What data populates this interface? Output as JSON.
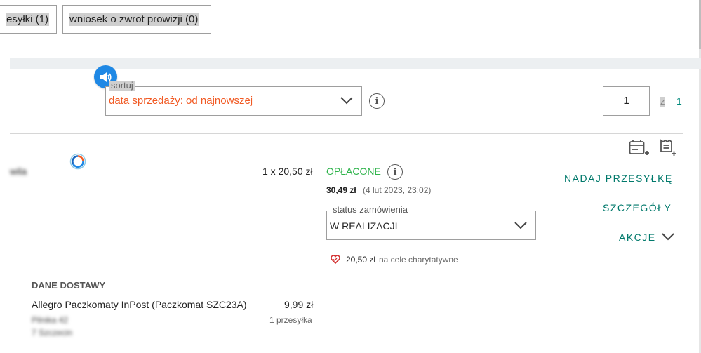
{
  "tabs": [
    {
      "label": "esyłki (1)"
    },
    {
      "label": "wniosek o zwrot prowizji (0)"
    }
  ],
  "sort": {
    "legend": "sortuj",
    "value": "data sprzedaży: od najnowszej"
  },
  "pagination": {
    "current": "1",
    "of": "z",
    "total": "1"
  },
  "order": {
    "item_name": "wila",
    "item_qty": "1 x 20,50 zł",
    "payment_status": "OPŁACONE",
    "paid_amount": "30,49 zł",
    "paid_date": "(4 lut 2023, 23:02)",
    "status_legend": "status zamówienia",
    "status_value": "W REALIZACJI",
    "charity_amount": "20,50 zł",
    "charity_text": "na cele charytatywne"
  },
  "actions": {
    "send": "NADAJ PRZESYŁKĘ",
    "details": "SZCZEGÓŁY",
    "more": "AKCJE"
  },
  "delivery": {
    "heading": "DANE DOSTAWY",
    "method": "Allegro Paczkomaty InPost (Paczkomat SZC23A)",
    "price": "9,99 zł",
    "shipments": "1 przesyłka",
    "address_line1": "Pilnika 42",
    "address_line2": "7 Szczecin"
  },
  "colors": {
    "accent": "#00796b",
    "sort_value": "#f15a24",
    "paid": "#2db34a",
    "speaker": "#1e88e5"
  },
  "icons": {
    "speaker": "speaker-icon",
    "info": "info-icon",
    "chevron": "chevron-down-icon",
    "add_invoice": "add-invoice-icon",
    "add_receipt": "add-receipt-icon",
    "ring": "refresh-ring-icon",
    "heart": "heart-icon"
  }
}
